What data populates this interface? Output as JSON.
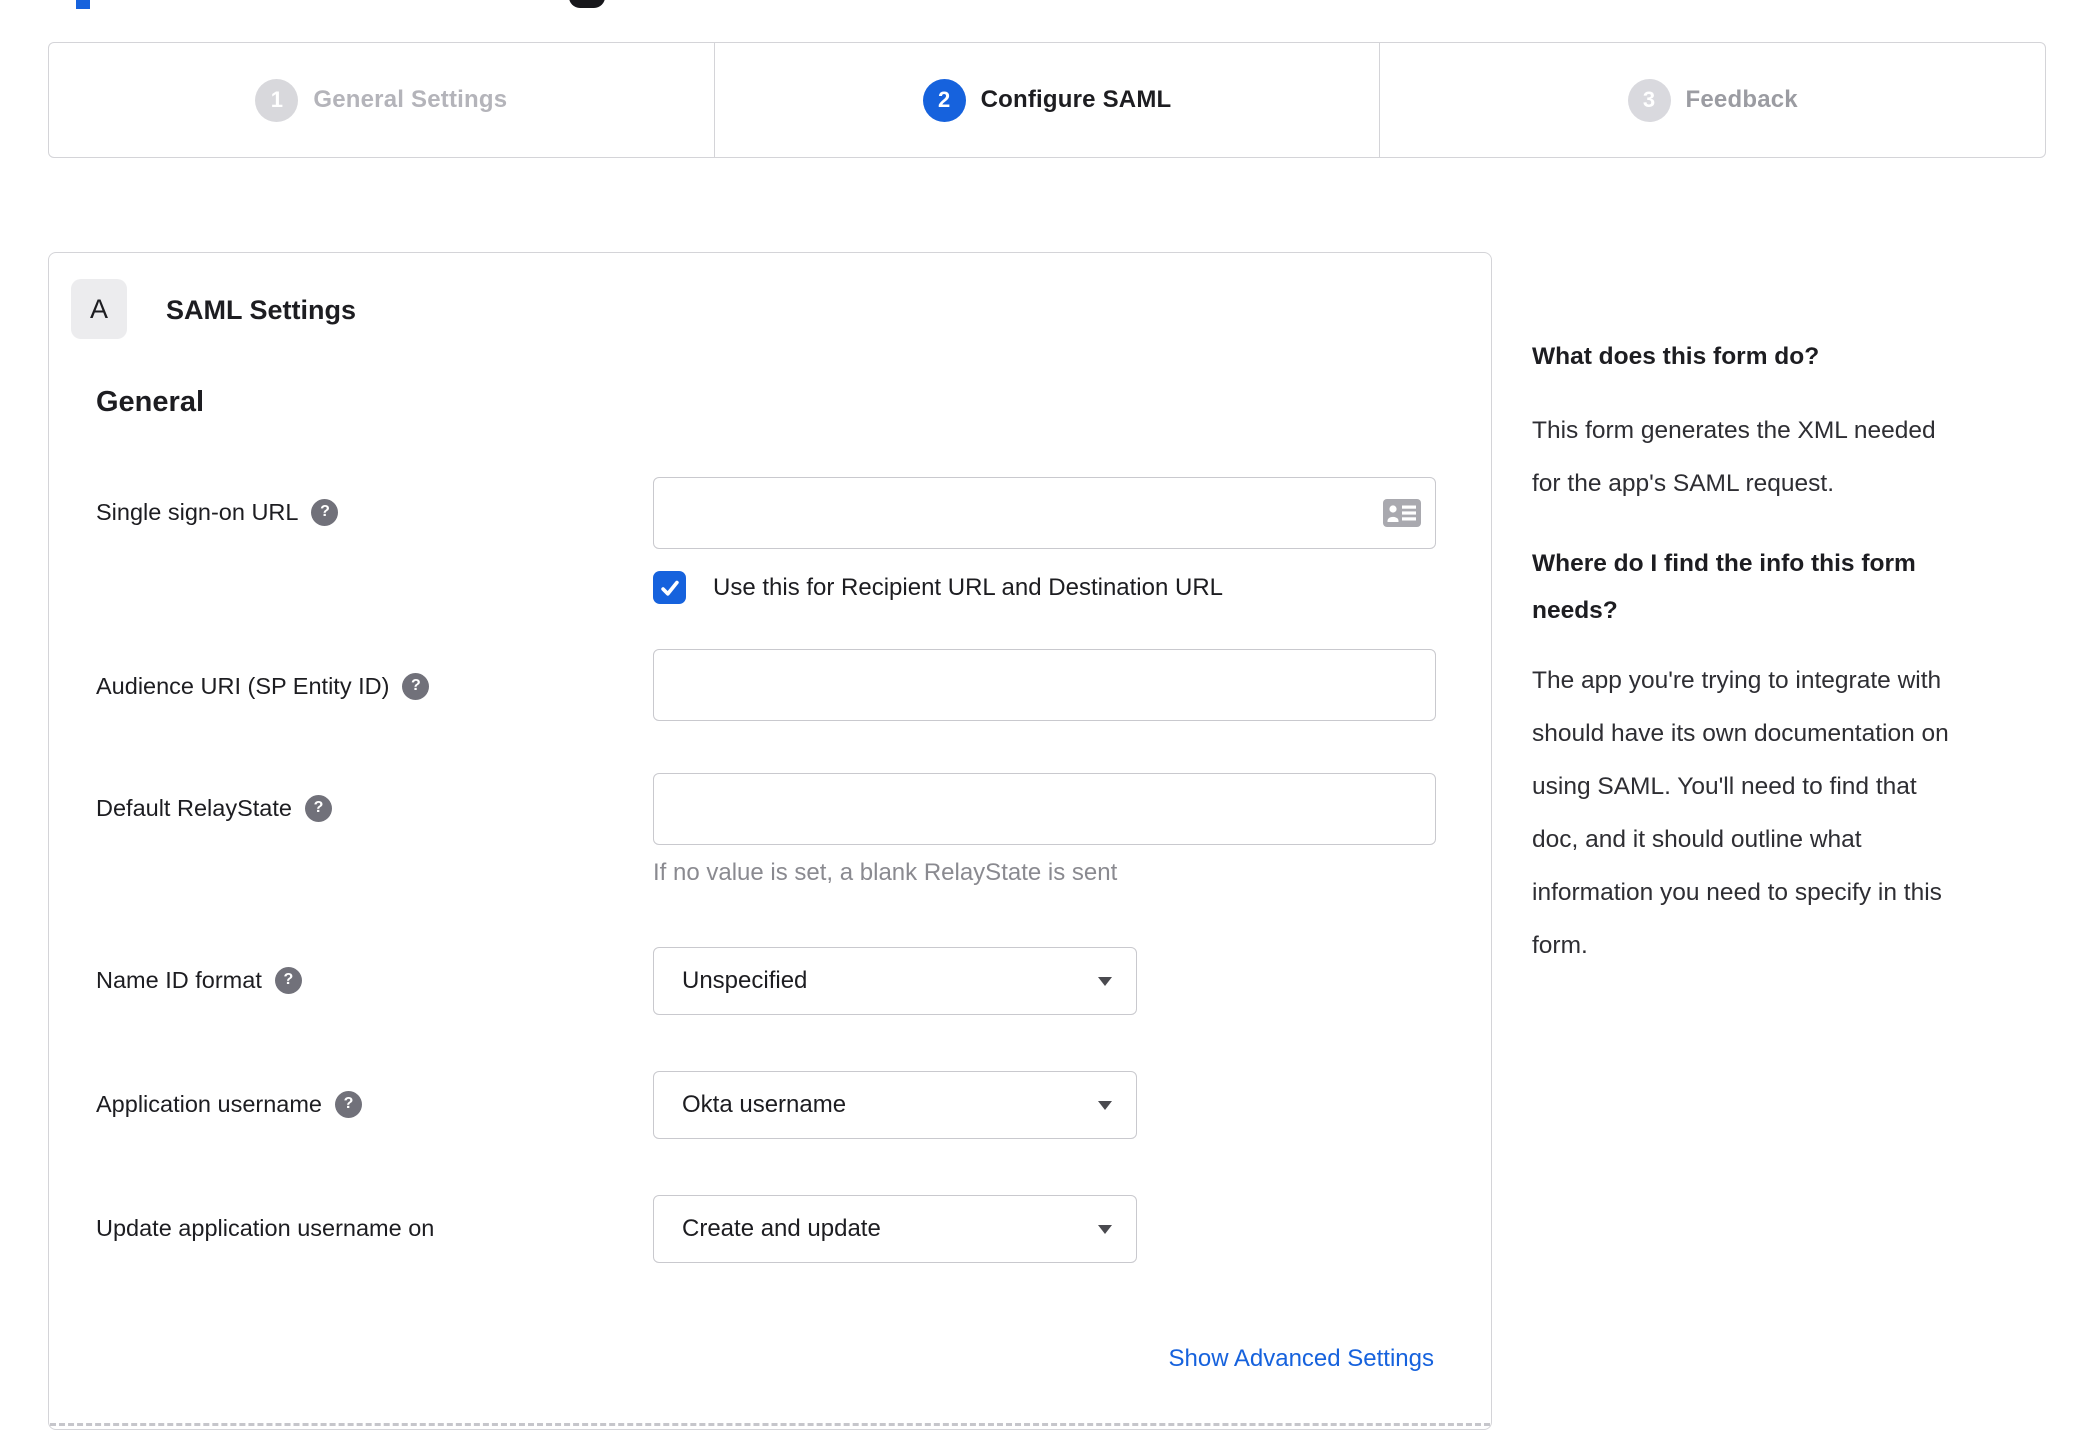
{
  "accent_color": "#1662dd",
  "stepper": {
    "steps": [
      {
        "number": "1",
        "label": "General Settings",
        "state": "done"
      },
      {
        "number": "2",
        "label": "Configure SAML",
        "state": "active"
      },
      {
        "number": "3",
        "label": "Feedback",
        "state": "future"
      }
    ]
  },
  "form": {
    "section_badge": "A",
    "section_title": "SAML Settings",
    "group_heading": "General",
    "rows": [
      {
        "label": "Single sign-on URL",
        "value": "",
        "checkbox_label": "Use this for Recipient URL and Destination URL",
        "checkbox_checked": true
      },
      {
        "label": "Audience URI (SP Entity ID)",
        "value": ""
      },
      {
        "label": "Default RelayState",
        "value": "",
        "helper": "If no value is set, a blank RelayState is sent"
      },
      {
        "label": "Name ID format",
        "value": "Unspecified"
      },
      {
        "label": "Application username",
        "value": "Okta username"
      },
      {
        "label": "Update application username on",
        "value": "Create and update"
      }
    ],
    "advanced_link": "Show Advanced Settings"
  },
  "help": {
    "q1": "What does this form do?",
    "a1": "This form generates the XML needed\nfor the app's SAML request.",
    "q2": "Where do I find the info this form\nneeds?",
    "a2": "The app you're trying to integrate with\nshould have its own documentation on\nusing SAML. You'll need to find that\ndoc, and it should outline what\ninformation you need to specify in this\nform."
  },
  "icons": {
    "help_glyph": "?"
  }
}
